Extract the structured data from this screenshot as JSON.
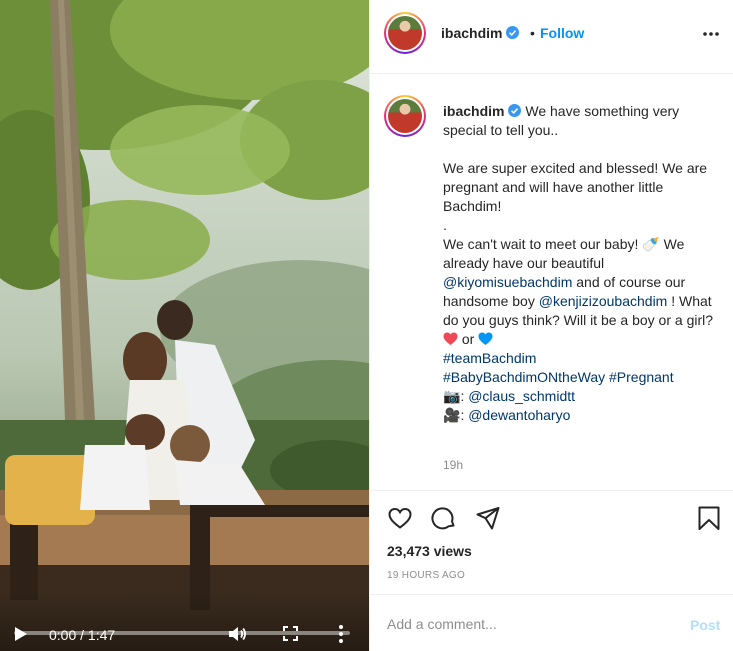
{
  "video": {
    "current_time": "0:00",
    "separator": " / ",
    "duration": "1:47",
    "progress_fraction": 0.0
  },
  "header": {
    "username": "ibachdim",
    "dot": "•",
    "follow_label": "Follow"
  },
  "caption": {
    "username": "ibachdim",
    "line1": "We have something very special to tell you..",
    "line2": "We are super excited and blessed! We are pregnant and will have another little Bachdim!",
    "line3": ".",
    "line4a": "We can't wait to meet our baby! 🍼 We already have our beautiful ",
    "mention1": "@kiyomisuebachdim",
    "line4b": " and of course our handsome boy ",
    "mention2": "@kenjizizoubachdim",
    "line4c": " ! What do you guys think? Will it be a boy or a girl?",
    "or_text": " or ",
    "hashtag1": "#teamBachdim",
    "hashtag2": "#BabyBachdimONtheWay",
    "hashtag3": "#Pregnant",
    "camera_emoji": "📷",
    "credit_sep": ": ",
    "credit1": "@claus_schmidtt",
    "video_emoji": "🎥",
    "credit2": "@dewantoharyo",
    "time_ago": "19h"
  },
  "stats": {
    "views": "23,473 views",
    "posted": "19 HOURS AGO"
  },
  "comment_box": {
    "placeholder": "Add a comment...",
    "post_label": "Post"
  },
  "colors": {
    "link": "#00376b",
    "follow": "#0095f6",
    "verified": "#3897f0",
    "heart_red": "#ed4956",
    "heart_blue": "#0095f6",
    "muted": "#8e8e8e"
  },
  "icons": {
    "controls": [
      "play-icon",
      "volume-icon",
      "fullscreen-icon",
      "more-vertical-icon"
    ],
    "actions": [
      "heart-icon",
      "comment-icon",
      "share-icon",
      "bookmark-icon"
    ],
    "header": [
      "verified-icon",
      "more-horizontal-icon"
    ]
  }
}
